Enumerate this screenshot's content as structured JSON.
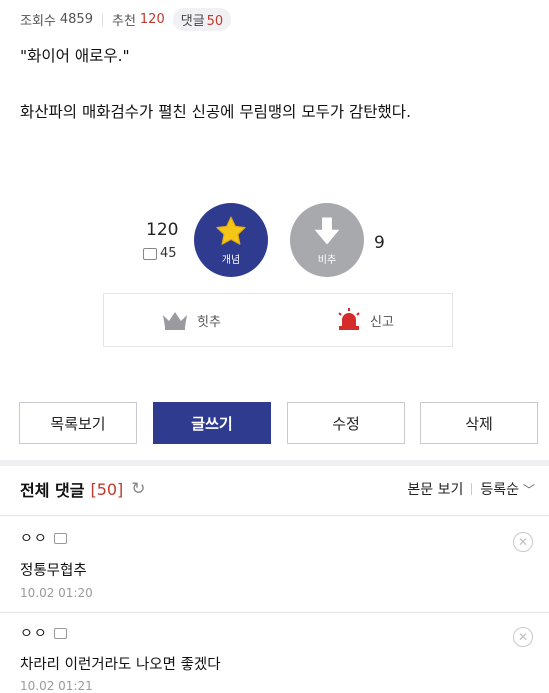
{
  "stats": {
    "views_label": "조회수",
    "views": "4859",
    "recommend_label": "추천",
    "recommend": "120",
    "comments_label": "댓글",
    "comments": "50"
  },
  "post": {
    "quote": "\"화이어 애로우.\"",
    "body": "화산파의 매화검수가 펼친 신공에 무림맹의 모두가 감탄했다."
  },
  "vote": {
    "up_count": "120",
    "up_sub_count": "45",
    "up_label": "개념",
    "down_label": "비추",
    "down_count": "9",
    "up_color": "#2f3b8f",
    "down_color": "#a8a9ad"
  },
  "report": {
    "hit_label": "힛추",
    "report_label": "신고"
  },
  "actions": {
    "list": "목록보기",
    "write": "글쓰기",
    "edit": "수정",
    "delete": "삭제"
  },
  "comments_header": {
    "title": "전체 댓글",
    "count": "[50]",
    "view_body": "본문 보기",
    "sort": "등록순"
  },
  "comments": [
    {
      "author": "ㅇㅇ",
      "text": "정통무협추",
      "date": "10.02 01:20"
    },
    {
      "author": "ㅇㅇ",
      "text": "차라리 이런거라도 나오면 좋겠다",
      "date": "10.02 01:21"
    }
  ]
}
